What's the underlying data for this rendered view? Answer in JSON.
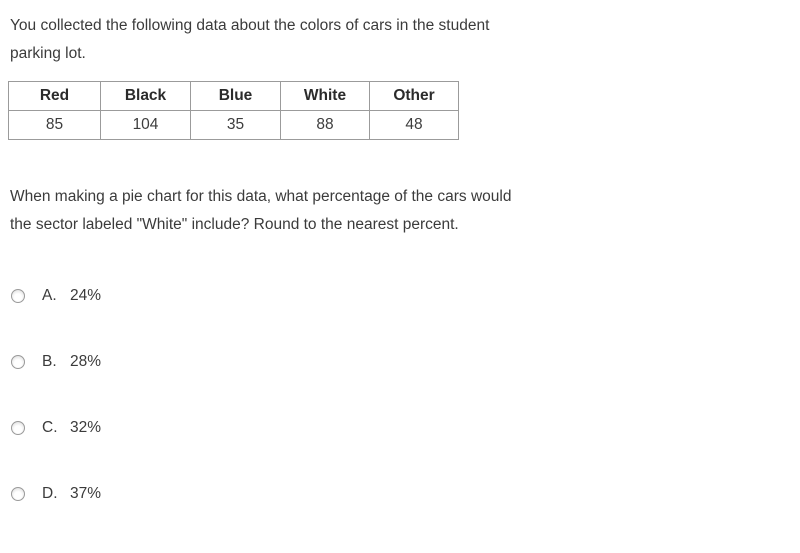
{
  "intro": {
    "text": "You collected the following data about the colors of cars in the student parking lot."
  },
  "table": {
    "headers": [
      "Red",
      "Black",
      "Blue",
      "White",
      "Other"
    ],
    "values": [
      "85",
      "104",
      "35",
      "88",
      "48"
    ]
  },
  "question": {
    "text": "When making a pie chart for this data, what percentage of the cars would the sector labeled \"White\" include? Round to the nearest percent."
  },
  "options": [
    {
      "letter": "A.",
      "value": "24%"
    },
    {
      "letter": "B.",
      "value": "28%"
    },
    {
      "letter": "C.",
      "value": "32%"
    },
    {
      "letter": "D.",
      "value": "37%"
    }
  ],
  "colors": {
    "text": "#3b3b3b",
    "header_text": "#2b2b2b",
    "border": "#9b9b9b",
    "background": "#ffffff"
  }
}
